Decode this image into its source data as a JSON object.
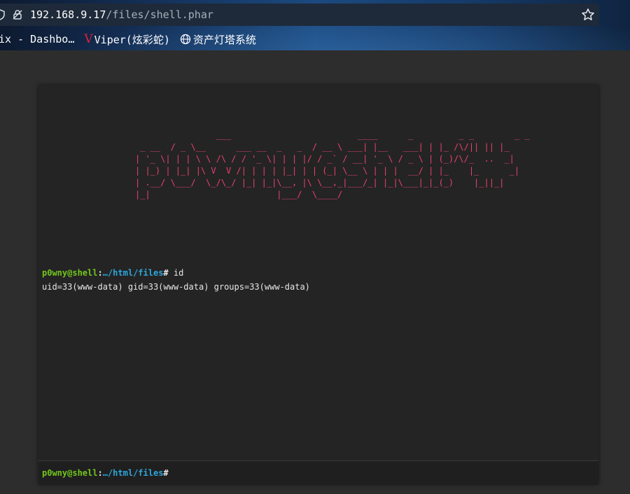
{
  "browser": {
    "url_host": "192.168.9.17",
    "url_path": "/files/shell.phar",
    "bookmarks": [
      {
        "label": "ix - Dashbo…",
        "icon": "none"
      },
      {
        "label": "Viper(炫彩蛇)",
        "icon": "viper-v-icon"
      },
      {
        "label": "资产灯塔系统",
        "icon": "globe-icon"
      }
    ],
    "viper_glyph": "V"
  },
  "terminal": {
    "banner": "                ___                         ____      _         _ _        _ _\n _ __  / _ \\__      ___ __  _   _  / __ \\ ___| |__   ___| | |_ /\\/|| || |_\n| '_ \\| | | \\ \\ /\\ / / '_ \\| | | |/ / _` / __| '_ \\ / _ \\ | (_)/\\/_  ..  _|\n| |_) | |_| |\\ V  V /| | | | |_| | | (_| \\__ \\ | | |  __/ | |_    |_      _|\n| .__/ \\___/  \\_/\\_/ |_| |_|\\__, |\\ \\__,_|___/_| |_|\\___|_|_(_)    |_||_|\n|_|                         |___/  \\____/",
    "history": [
      {
        "user": "p0wny@shell",
        "sep": ":",
        "path": "…/html/files",
        "hash": "#",
        "command": " id",
        "output": "uid=33(www-data) gid=33(www-data) groups=33(www-data)"
      }
    ],
    "prompt": {
      "user": "p0wny@shell",
      "sep": ":",
      "path": "…/html/files",
      "hash": "#"
    },
    "input_value": ""
  },
  "colors": {
    "banner": "#e8426e",
    "prompt_user": "#74c61c",
    "prompt_path": "#2ea6db",
    "terminal_bg": "#242424"
  }
}
